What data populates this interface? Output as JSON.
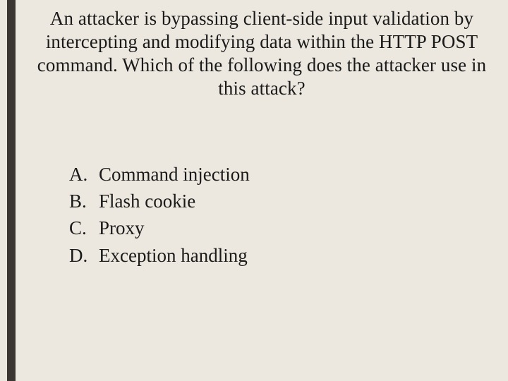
{
  "question": "An attacker is bypassing client-side input validation by intercepting and modifying data within the HTTP POST command. Which of the following does the attacker use in this attack?",
  "options": [
    {
      "label": "A.",
      "text": "Command injection"
    },
    {
      "label": "B.",
      "text": "Flash cookie"
    },
    {
      "label": "C.",
      "text": "Proxy"
    },
    {
      "label": "D.",
      "text": "Exception handling"
    }
  ]
}
